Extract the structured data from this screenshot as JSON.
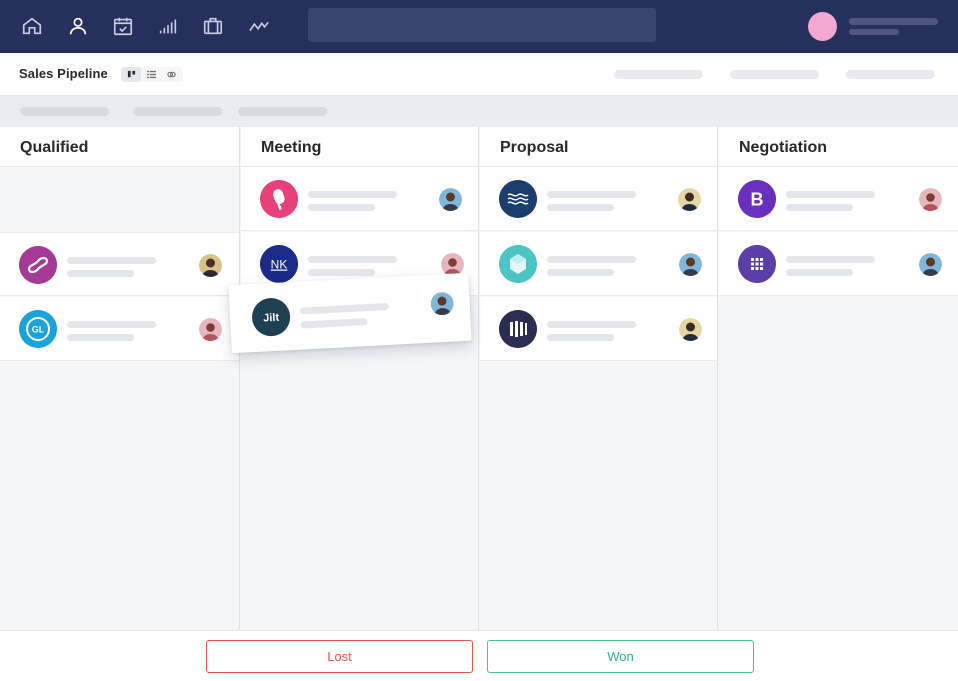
{
  "nav": {
    "icons": [
      "home-icon",
      "person-icon",
      "calendar-icon",
      "bar-chart-icon",
      "briefcase-icon",
      "trend-icon"
    ],
    "avatar_color": "#f2a8cf"
  },
  "header": {
    "title": "Sales Pipeline",
    "views": [
      "board-view-icon",
      "list-view-icon",
      "forecast-view-icon"
    ]
  },
  "columns": [
    {
      "title": "Qualified"
    },
    {
      "title": "Meeting"
    },
    {
      "title": "Proposal"
    },
    {
      "title": "Negotiation"
    }
  ],
  "drop_zones": {
    "lost": "Lost",
    "won": "Won"
  },
  "colors": {
    "nav_bg": "#25305e",
    "lost": "#e3574a",
    "won": "#3ec596"
  },
  "cards": {
    "drag_card_logo_text": "Jilt",
    "nk_logo_text": "NK",
    "gl_logo_text": "GL",
    "b_logo_text": "B"
  }
}
